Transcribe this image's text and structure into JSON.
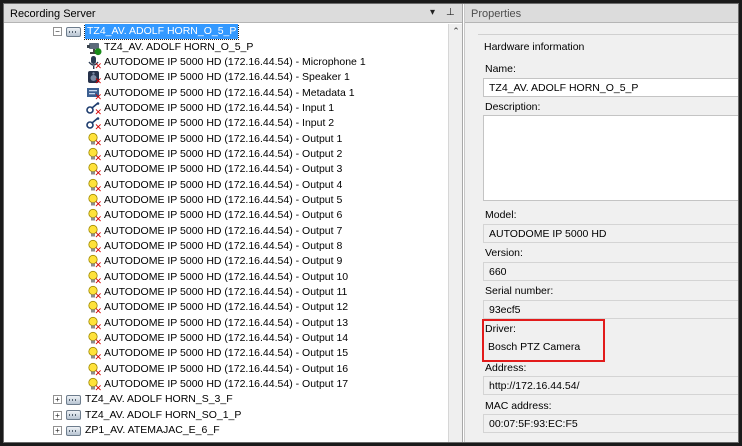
{
  "left_pane": {
    "title": "Recording Server",
    "dropdown_glyph": "▾",
    "pin_glyph": "⊥"
  },
  "tree": {
    "root_selected": "TZ4_AV. ADOLF HORN_O_5_P",
    "device_name": "TZ4_AV. ADOLF HORN_O_5_P",
    "children": [
      {
        "label": "AUTODOME IP 5000 HD (172.16.44.54) - Microphone 1",
        "icon": "microphone-icon"
      },
      {
        "label": "AUTODOME IP 5000 HD (172.16.44.54) - Speaker 1",
        "icon": "speaker-icon"
      },
      {
        "label": "AUTODOME IP 5000 HD (172.16.44.54) - Metadata 1",
        "icon": "metadata-icon"
      },
      {
        "label": "AUTODOME IP 5000 HD (172.16.44.54) - Input 1",
        "icon": "input-icon"
      },
      {
        "label": "AUTODOME IP 5000 HD (172.16.44.54) - Input 2",
        "icon": "input-icon"
      },
      {
        "label": "AUTODOME IP 5000 HD (172.16.44.54) - Output 1",
        "icon": "output-icon"
      },
      {
        "label": "AUTODOME IP 5000 HD (172.16.44.54) - Output 2",
        "icon": "output-icon"
      },
      {
        "label": "AUTODOME IP 5000 HD (172.16.44.54) - Output 3",
        "icon": "output-icon"
      },
      {
        "label": "AUTODOME IP 5000 HD (172.16.44.54) - Output 4",
        "icon": "output-icon"
      },
      {
        "label": "AUTODOME IP 5000 HD (172.16.44.54) - Output 5",
        "icon": "output-icon"
      },
      {
        "label": "AUTODOME IP 5000 HD (172.16.44.54) - Output 6",
        "icon": "output-icon"
      },
      {
        "label": "AUTODOME IP 5000 HD (172.16.44.54) - Output 7",
        "icon": "output-icon"
      },
      {
        "label": "AUTODOME IP 5000 HD (172.16.44.54) - Output 8",
        "icon": "output-icon"
      },
      {
        "label": "AUTODOME IP 5000 HD (172.16.44.54) - Output 9",
        "icon": "output-icon"
      },
      {
        "label": "AUTODOME IP 5000 HD (172.16.44.54) - Output 10",
        "icon": "output-icon"
      },
      {
        "label": "AUTODOME IP 5000 HD (172.16.44.54) - Output 11",
        "icon": "output-icon"
      },
      {
        "label": "AUTODOME IP 5000 HD (172.16.44.54) - Output 12",
        "icon": "output-icon"
      },
      {
        "label": "AUTODOME IP 5000 HD (172.16.44.54) - Output 13",
        "icon": "output-icon"
      },
      {
        "label": "AUTODOME IP 5000 HD (172.16.44.54) - Output 14",
        "icon": "output-icon"
      },
      {
        "label": "AUTODOME IP 5000 HD (172.16.44.54) - Output 15",
        "icon": "output-icon"
      },
      {
        "label": "AUTODOME IP 5000 HD (172.16.44.54) - Output 16",
        "icon": "output-icon"
      },
      {
        "label": "AUTODOME IP 5000 HD (172.16.44.54) - Output 17",
        "icon": "output-icon"
      }
    ],
    "siblings": [
      "TZ4_AV. ADOLF HORN_S_3_F",
      "TZ4_AV. ADOLF HORN_SO_1_P",
      "ZP1_AV. ATEMAJAC_E_6_F"
    ]
  },
  "properties": {
    "title": "Properties",
    "group": "Hardware information",
    "name_label": "Name:",
    "name_value": "TZ4_AV. ADOLF HORN_O_5_P",
    "description_label": "Description:",
    "description_value": "",
    "model_label": "Model:",
    "model_value": "AUTODOME IP 5000 HD",
    "version_label": "Version:",
    "version_value": "660",
    "serial_label": "Serial number:",
    "serial_value": "93ecf5",
    "driver_label": "Driver:",
    "driver_value": "Bosch PTZ Camera",
    "address_label": "Address:",
    "address_value": "http://172.16.44.54/",
    "mac_label": "MAC address:",
    "mac_value": "00:07:5F:93:EC:F5"
  },
  "colors": {
    "selection": "#3399ff",
    "highlight_box": "#e21b1b",
    "error_x": "#d40000"
  }
}
